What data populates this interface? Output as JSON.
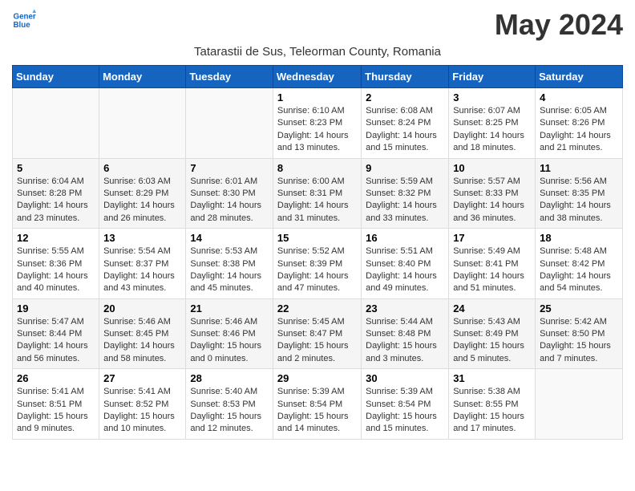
{
  "header": {
    "logo_line1": "General",
    "logo_line2": "Blue",
    "month": "May 2024",
    "subtitle": "Tatarastii de Sus, Teleorman County, Romania"
  },
  "weekdays": [
    "Sunday",
    "Monday",
    "Tuesday",
    "Wednesday",
    "Thursday",
    "Friday",
    "Saturday"
  ],
  "weeks": [
    [
      {
        "day": "",
        "info": ""
      },
      {
        "day": "",
        "info": ""
      },
      {
        "day": "",
        "info": ""
      },
      {
        "day": "1",
        "info": "Sunrise: 6:10 AM\nSunset: 8:23 PM\nDaylight: 14 hours\nand 13 minutes."
      },
      {
        "day": "2",
        "info": "Sunrise: 6:08 AM\nSunset: 8:24 PM\nDaylight: 14 hours\nand 15 minutes."
      },
      {
        "day": "3",
        "info": "Sunrise: 6:07 AM\nSunset: 8:25 PM\nDaylight: 14 hours\nand 18 minutes."
      },
      {
        "day": "4",
        "info": "Sunrise: 6:05 AM\nSunset: 8:26 PM\nDaylight: 14 hours\nand 21 minutes."
      }
    ],
    [
      {
        "day": "5",
        "info": "Sunrise: 6:04 AM\nSunset: 8:28 PM\nDaylight: 14 hours\nand 23 minutes."
      },
      {
        "day": "6",
        "info": "Sunrise: 6:03 AM\nSunset: 8:29 PM\nDaylight: 14 hours\nand 26 minutes."
      },
      {
        "day": "7",
        "info": "Sunrise: 6:01 AM\nSunset: 8:30 PM\nDaylight: 14 hours\nand 28 minutes."
      },
      {
        "day": "8",
        "info": "Sunrise: 6:00 AM\nSunset: 8:31 PM\nDaylight: 14 hours\nand 31 minutes."
      },
      {
        "day": "9",
        "info": "Sunrise: 5:59 AM\nSunset: 8:32 PM\nDaylight: 14 hours\nand 33 minutes."
      },
      {
        "day": "10",
        "info": "Sunrise: 5:57 AM\nSunset: 8:33 PM\nDaylight: 14 hours\nand 36 minutes."
      },
      {
        "day": "11",
        "info": "Sunrise: 5:56 AM\nSunset: 8:35 PM\nDaylight: 14 hours\nand 38 minutes."
      }
    ],
    [
      {
        "day": "12",
        "info": "Sunrise: 5:55 AM\nSunset: 8:36 PM\nDaylight: 14 hours\nand 40 minutes."
      },
      {
        "day": "13",
        "info": "Sunrise: 5:54 AM\nSunset: 8:37 PM\nDaylight: 14 hours\nand 43 minutes."
      },
      {
        "day": "14",
        "info": "Sunrise: 5:53 AM\nSunset: 8:38 PM\nDaylight: 14 hours\nand 45 minutes."
      },
      {
        "day": "15",
        "info": "Sunrise: 5:52 AM\nSunset: 8:39 PM\nDaylight: 14 hours\nand 47 minutes."
      },
      {
        "day": "16",
        "info": "Sunrise: 5:51 AM\nSunset: 8:40 PM\nDaylight: 14 hours\nand 49 minutes."
      },
      {
        "day": "17",
        "info": "Sunrise: 5:49 AM\nSunset: 8:41 PM\nDaylight: 14 hours\nand 51 minutes."
      },
      {
        "day": "18",
        "info": "Sunrise: 5:48 AM\nSunset: 8:42 PM\nDaylight: 14 hours\nand 54 minutes."
      }
    ],
    [
      {
        "day": "19",
        "info": "Sunrise: 5:47 AM\nSunset: 8:44 PM\nDaylight: 14 hours\nand 56 minutes."
      },
      {
        "day": "20",
        "info": "Sunrise: 5:46 AM\nSunset: 8:45 PM\nDaylight: 14 hours\nand 58 minutes."
      },
      {
        "day": "21",
        "info": "Sunrise: 5:46 AM\nSunset: 8:46 PM\nDaylight: 15 hours\nand 0 minutes."
      },
      {
        "day": "22",
        "info": "Sunrise: 5:45 AM\nSunset: 8:47 PM\nDaylight: 15 hours\nand 2 minutes."
      },
      {
        "day": "23",
        "info": "Sunrise: 5:44 AM\nSunset: 8:48 PM\nDaylight: 15 hours\nand 3 minutes."
      },
      {
        "day": "24",
        "info": "Sunrise: 5:43 AM\nSunset: 8:49 PM\nDaylight: 15 hours\nand 5 minutes."
      },
      {
        "day": "25",
        "info": "Sunrise: 5:42 AM\nSunset: 8:50 PM\nDaylight: 15 hours\nand 7 minutes."
      }
    ],
    [
      {
        "day": "26",
        "info": "Sunrise: 5:41 AM\nSunset: 8:51 PM\nDaylight: 15 hours\nand 9 minutes."
      },
      {
        "day": "27",
        "info": "Sunrise: 5:41 AM\nSunset: 8:52 PM\nDaylight: 15 hours\nand 10 minutes."
      },
      {
        "day": "28",
        "info": "Sunrise: 5:40 AM\nSunset: 8:53 PM\nDaylight: 15 hours\nand 12 minutes."
      },
      {
        "day": "29",
        "info": "Sunrise: 5:39 AM\nSunset: 8:54 PM\nDaylight: 15 hours\nand 14 minutes."
      },
      {
        "day": "30",
        "info": "Sunrise: 5:39 AM\nSunset: 8:54 PM\nDaylight: 15 hours\nand 15 minutes."
      },
      {
        "day": "31",
        "info": "Sunrise: 5:38 AM\nSunset: 8:55 PM\nDaylight: 15 hours\nand 17 minutes."
      },
      {
        "day": "",
        "info": ""
      }
    ]
  ]
}
